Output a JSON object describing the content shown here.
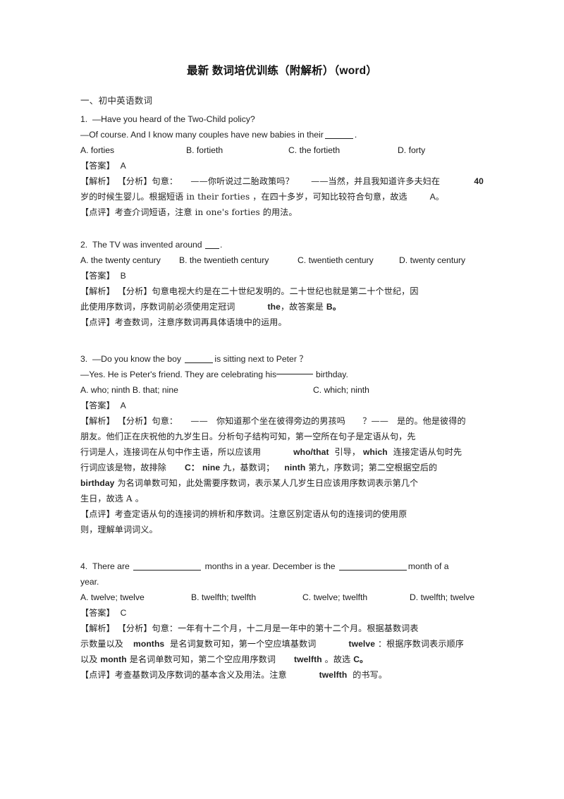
{
  "document": {
    "title": "最新 数词培优训练（附解析）（word）",
    "section_heading": "一、初中英语数词"
  },
  "questions": [
    {
      "number": "1.",
      "stem_line1": "—Have you heard of the Two-Child policy?",
      "stem_line2_pre": "—Of course. And I know many couples have new babies in their",
      "stem_line2_post": ".",
      "options": [
        "A. forties",
        "B. fortieth",
        "C. the fortieth",
        "D. forty"
      ],
      "answer_label": "【答案】",
      "answer_value": "A",
      "analysis_label": "【解析】",
      "analysis_tag": "【分析】",
      "analysis_lines": [
        "句意：　　——你听说过二胎政策吗？　　——当然，并且我知道许多夫妇在",
        "岁的时候生婴儿。根据短语 in their forties ，在四十多岁，可知比较符合句意，故选",
        ""
      ],
      "analysis_hang_1": "40",
      "analysis_hang_2": "A。",
      "comment_label": "【点评】",
      "comment": "考查介词短语，注意 in one's forties 的用法。"
    },
    {
      "number": "2.",
      "stem_line1_pre": "The TV was invented around",
      "stem_line1_post": ".",
      "options": [
        "A. the twenty century",
        "B. the twentieth century",
        "C. twentieth century",
        "D. twenty century"
      ],
      "answer_label": "【答案】",
      "answer_value": "B",
      "analysis_label": "【解析】",
      "analysis_tag": "【分析】",
      "analysis_lines": [
        "句意电视大约是在二十世纪发明的。二十世纪也就是第二十个世纪，因",
        "此使用序数词，序数词前必须使用定冠词"
      ],
      "analysis_inline_word": "the",
      "analysis_tail": "，故答案是",
      "analysis_tail_answer": "B。",
      "comment_label": "【点评】",
      "comment": "考查数词，注意序数词再具体语境中的运用。"
    },
    {
      "number": "3.",
      "stem_line1_pre": "—Do you know the boy",
      "stem_line1_mid": "is sitting next to Peter",
      "stem_line1_post": "？",
      "stem_line2_pre": "—Yes. He is Peter's friend. They are celebrating his",
      "stem_line2_post": "birthday.",
      "options_ab": "A. who; ninth B. that; nine",
      "options_c": "C. which; ninth",
      "answer_label": "【答案】",
      "answer_value": "A",
      "analysis_label": "【解析】",
      "analysis_tag": "【分析】",
      "analysis_line1": "句意：　　——　你知道那个坐在彼得旁边的男孩吗　　？——　是的。他是彼得的",
      "analysis_line2": "朋友。他们正在庆祝他的九岁生日。分析句子结构可知，第一空所在句子是定语从句，先",
      "analysis_line3_a": "行词是人，连接词在从句中作主语，所以应该用",
      "analysis_line3_w1": "who/that",
      "analysis_line3_b": "引导，",
      "analysis_line3_w2": "which",
      "analysis_line3_c": "连接定语从句时先",
      "analysis_line4_a": "行词应该是物，故排除",
      "analysis_line4_w1": "C：",
      "analysis_line4_w2": "nine",
      "analysis_line4_b": "九，基数词；",
      "analysis_line4_w3": "ninth",
      "analysis_line4_c": "第九，序数词；第二空根据空后的",
      "analysis_line5_w": "birthday",
      "analysis_line5_a": "为名词单数可知，此处需要序数词，表示某人几岁生日应该用序数词表示第几个",
      "analysis_line6": "生日，故选 A 。",
      "comment_label": "【点评】",
      "comment_line1": "考查定语从句的连接词的辨析和序数词。注意区别定语从句的连接词的使用原",
      "comment_line2": "则，理解单词词义。"
    },
    {
      "number": "4.",
      "stem_line1_a": "There are",
      "stem_line1_b": "months in a year. December is the",
      "stem_line1_c": "month of a",
      "stem_line2": "year.",
      "options": [
        "A. twelve; twelve",
        "B. twelfth; twelfth",
        "C. twelve; twelfth",
        "D. twelfth; twelve"
      ],
      "answer_label": "【答案】",
      "answer_value": "C",
      "analysis_label": "【解析】",
      "analysis_tag": "【分析】",
      "analysis_line1": "句意：一年有十二个月，十二月是一年中的第十二个月。根据基数词表",
      "analysis_line2_a": "示数量以及",
      "analysis_line2_w1": "months",
      "analysis_line2_b": "是名词复数可知，第一个空应填基数词",
      "analysis_line2_w2": "twelve",
      "analysis_line2_c": "：根据序数词表示顺序",
      "analysis_line3_a": "以及",
      "analysis_line3_w1": "month",
      "analysis_line3_b": "是名词单数可知，第二个空应用序数词",
      "analysis_line3_w2": "twelfth",
      "analysis_line3_c": "。故选",
      "analysis_line3_answer": "C。",
      "comment_label": "【点评】",
      "comment_a": "考查基数词及序数词的基本含义及用法。注意",
      "comment_w": "twelfth",
      "comment_b": "的书写。"
    }
  ]
}
